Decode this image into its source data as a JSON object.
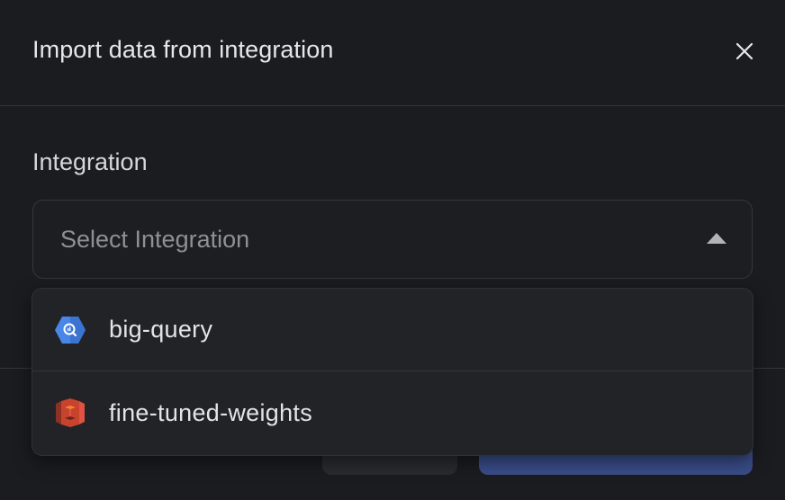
{
  "modal": {
    "title": "Import data from integration"
  },
  "form": {
    "integration_label": "Integration",
    "select_placeholder": "Select Integration"
  },
  "dropdown": {
    "options": [
      {
        "label": "big-query",
        "icon": "bigquery-icon"
      },
      {
        "label": "fine-tuned-weights",
        "icon": "aws-s3-icon"
      }
    ]
  },
  "colors": {
    "background": "#1b1c20",
    "primary_button": "#3a4d8a",
    "bigquery_blue": "#4a86e8",
    "s3_red": "#c7432d"
  }
}
